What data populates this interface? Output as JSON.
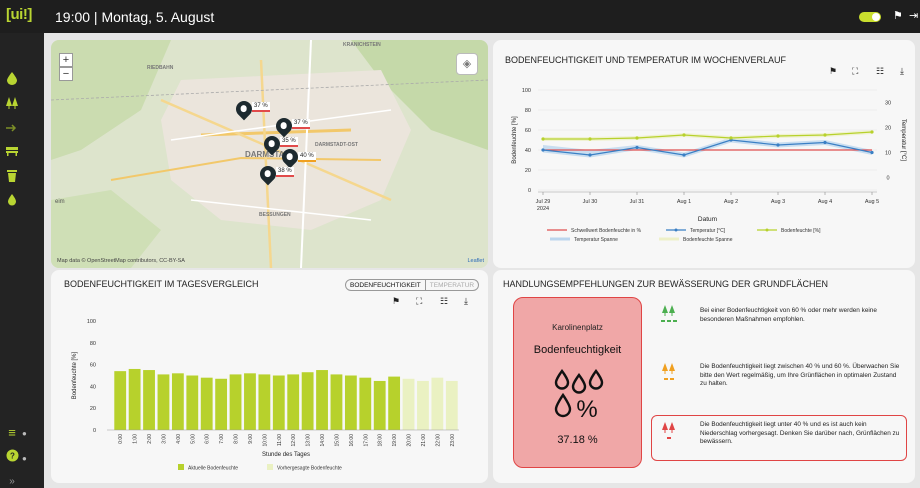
{
  "app": {
    "logo": "[ui!]",
    "clock": "19:00 | Montag, 5. August"
  },
  "topbar": {
    "toggle_on": true,
    "flag_icon": "flag-icon",
    "exit_icon": "exit-icon"
  },
  "sidebar": {
    "items": [
      "drop-icon",
      "tree-icon",
      "arrow-icon",
      "bench-icon",
      "trash-icon",
      "water-icon"
    ],
    "bottom": [
      "menu-icon",
      "help-icon"
    ],
    "expand": "»"
  },
  "map": {
    "attribution": "Map data © OpenStreetMap contributors, CC-BY-SA",
    "leaflet": "Leaflet",
    "zoom_in": "+",
    "zoom_out": "−",
    "places": [
      "KRANICHSTEIN",
      "RIEDBAHN",
      "DARMSTADT",
      "DARMSTADT-OST",
      "BESSUNGEN",
      "eim"
    ],
    "markers": [
      "37 %",
      "37 %",
      "35 %",
      "40 %",
      "38 %"
    ]
  },
  "week": {
    "title": "BODENFEUCHTIGKEIT UND TEMPERATUR IM WOCHENVERLAUF",
    "ylabel_left": "Bodenfeuchte [%]",
    "ylabel_right": "Temperatur [°C]",
    "xlabel": "Datum",
    "legend": [
      "Schwellwert Bodenfeuchte in %",
      "Temperatur [°C]",
      "Bodenfeuchte [%]",
      "Temperatur Spanne",
      "Bodenfeuchte Spanne"
    ]
  },
  "day": {
    "title": "BODENFEUCHTIGKEIT IM TAGESVERGLEICH",
    "tab_active": "BODENFEUCHTIGKEIT",
    "tab_inactive": "TEMPERATUR",
    "ylabel": "Bodenfeuchte [%]",
    "xlabel": "Stunde des Tages",
    "legend_actual": "Aktuelle Bodenfeuchte",
    "legend_forecast": "Vorhergesagte Bodenfeuchte"
  },
  "rec": {
    "title": "HANDLUNGSEMPFEHLUNGEN ZUR BEWÄSSERUNG DER GRUNDFLÄCHEN",
    "card_place": "Karolinenplatz",
    "card_metric": "Bodenfeuchtigkeit",
    "card_value": "37.18 %",
    "items": [
      {
        "text": "Bei einer Bodenfeuchtigkeit von 60 % oder mehr werden keine besonderen Maßnahmen empfohlen.",
        "color": "#4caf50"
      },
      {
        "text": "Die Bodenfeuchtigkeit liegt zwischen 40 % und 60 %. Überwachen Sie bitte den Wert regelmäßig, um Ihre Grünflächen in optimalen Zustand zu halten.",
        "color": "#f0a020"
      },
      {
        "text": "Die Bodenfeuchtigkeit liegt unter 40 % und es ist auch kein Niederschlag vorhergesagt. Denken Sie darüber nach, Grünflächen zu bewässern.",
        "color": "#e04545"
      }
    ]
  },
  "chart_data": [
    {
      "type": "line",
      "title": "BODENFEUCHTIGKEIT UND TEMPERATUR IM WOCHENVERLAUF",
      "xlabel": "Datum",
      "ylabel": "Bodenfeuchte [%]",
      "y2label": "Temperatur [°C]",
      "x": [
        "Jul 29",
        "Jul 30",
        "Jul 31",
        "Aug 1",
        "Aug 2",
        "Aug 3",
        "Aug 4",
        "Aug 5"
      ],
      "x_sub": [
        "2024",
        "",
        "",
        "",
        "",
        "",
        "",
        ""
      ],
      "ylim": [
        0,
        100
      ],
      "y_ticks": [
        0,
        20,
        40,
        60,
        80,
        100
      ],
      "y2lim": [
        -5,
        35
      ],
      "y2_ticks": [
        0,
        10,
        20,
        30
      ],
      "grid": true,
      "legend": "bottom",
      "series": [
        {
          "name": "Schwellwert Bodenfeuchte in %",
          "axis": "left",
          "color": "#e05050",
          "values": [
            40,
            40,
            40,
            40,
            40,
            40,
            40,
            40
          ]
        },
        {
          "name": "Temperatur [°C]",
          "axis": "right",
          "color": "#3a7fc4",
          "values": [
            11,
            9,
            12,
            9,
            15,
            13,
            14,
            10
          ]
        },
        {
          "name": "Bodenfeuchte [%]",
          "axis": "left",
          "color": "#b7d12c",
          "values": [
            51,
            51,
            52,
            55,
            52,
            54,
            55,
            58
          ]
        },
        {
          "name": "Temperatur Spanne",
          "axis": "right",
          "color": "#bcd6ee",
          "band": true,
          "low": [
            10,
            8,
            11,
            8,
            14,
            12,
            13,
            9
          ],
          "high": [
            13,
            11,
            13,
            10,
            16,
            14,
            15,
            11
          ]
        },
        {
          "name": "Bodenfeuchte Spanne",
          "axis": "left",
          "color": "#eef0c8",
          "band": true,
          "low": [
            49,
            49,
            50,
            53,
            50,
            52,
            53,
            56
          ],
          "high": [
            53,
            53,
            54,
            57,
            54,
            56,
            57,
            60
          ]
        }
      ]
    },
    {
      "type": "bar",
      "title": "BODENFEUCHTIGKEIT IM TAGESVERGLEICH",
      "xlabel": "Stunde des Tages",
      "ylabel": "Bodenfeuchte [%]",
      "categories": [
        "0:00",
        "1:00",
        "2:00",
        "3:00",
        "4:00",
        "5:00",
        "6:00",
        "7:00",
        "8:00",
        "9:00",
        "10:00",
        "11:00",
        "12:00",
        "13:00",
        "14:00",
        "15:00",
        "16:00",
        "17:00",
        "18:00",
        "19:00",
        "20:00",
        "21:00",
        "22:00",
        "23:00"
      ],
      "ylim": [
        0,
        100
      ],
      "y_ticks": [
        0,
        20,
        40,
        60,
        80,
        100
      ],
      "legend": "bottom",
      "series": [
        {
          "name": "Aktuelle Bodenfeuchte",
          "color": "#b7d12c",
          "values": [
            54,
            56,
            55,
            51,
            52,
            50,
            48,
            47,
            51,
            52,
            51,
            50,
            51,
            53,
            55,
            51,
            50,
            48,
            45,
            49,
            null,
            null,
            null,
            null
          ]
        },
        {
          "name": "Vorhergesagte Bodenfeuchte",
          "color": "#eaf1c2",
          "values": [
            null,
            null,
            null,
            null,
            null,
            null,
            null,
            null,
            null,
            null,
            null,
            null,
            null,
            null,
            null,
            null,
            null,
            null,
            null,
            null,
            47,
            45,
            48,
            45
          ]
        }
      ]
    }
  ]
}
